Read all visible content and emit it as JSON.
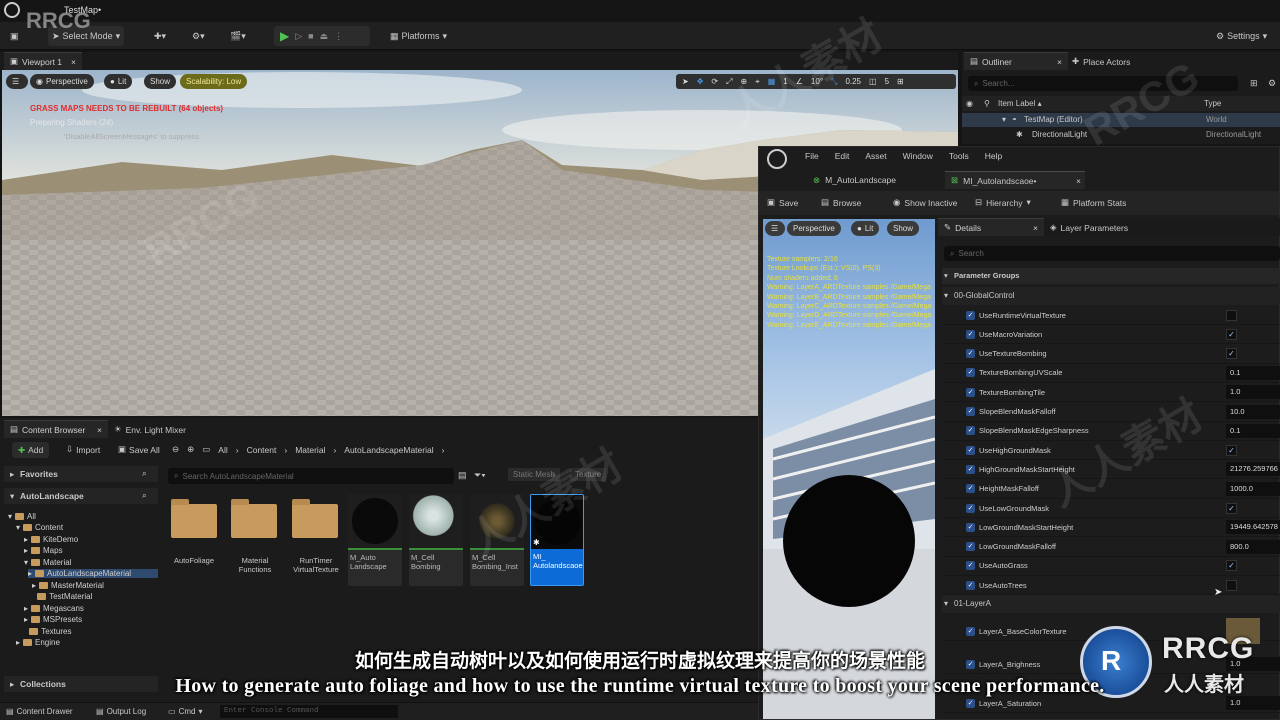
{
  "app": {
    "map_name": "TestMap•",
    "mode": "Select Mode",
    "platforms": "Platforms",
    "settings": "Settings"
  },
  "viewport": {
    "tab": "Viewport 1",
    "perspective": "Perspective",
    "lit": "Lit",
    "show": "Show",
    "scalability": "Scalability: Low",
    "warning": "GRASS MAPS NEEDS TO BE REBUILT (64 objects)",
    "shaders": "Preparing Shaders (24)",
    "suppress": "'DisableAllScreenMessages' to suppress",
    "grid": "1",
    "angle": "10°",
    "scale": "0.25",
    "cam_speed": "5"
  },
  "outliner": {
    "tab": "Outliner",
    "place_actors": "Place Actors",
    "search_placeholder": "Search...",
    "col_label": "Item Label ▴",
    "col_type": "Type",
    "rows": [
      {
        "label": "TestMap (Editor)",
        "type": "World"
      },
      {
        "label": "DirectionalLight",
        "type": "DirectionalLight"
      }
    ]
  },
  "content_browser": {
    "tab": "Content Browser",
    "env_tab": "Env. Light Mixer",
    "add": "Add",
    "import": "Import",
    "save_all": "Save All",
    "crumbs": [
      "All",
      "Content",
      "Material",
      "AutoLandscapeMaterial"
    ],
    "favorites": "Favorites",
    "project": "AutoLandscape",
    "search_placeholder": "Search AutoLandscapeMaterial",
    "filter1": "Static Mesh",
    "filter2": "Texture",
    "collections": "Collections",
    "tree": [
      "All",
      "Content",
      "KiteDemo",
      "Maps",
      "Material",
      "AutoLandscapeMaterial",
      "MasterMaterial",
      "TestMaterial",
      "Megascans",
      "MSPresets",
      "Textures",
      "Engine"
    ],
    "folders": [
      "AutoFoliage",
      "Material Functions",
      "RunTimer VirtualTexture"
    ],
    "assets": [
      "M_Auto Landscape",
      "M_Cell Bombing",
      "M_Cell Bombing_Inst",
      "MI_ Autolandscaoe"
    ]
  },
  "bottom_bar": {
    "drawer": "Content Drawer",
    "output": "Output Log",
    "cmd": "Cmd",
    "console_placeholder": "Enter Console Command"
  },
  "mi_editor": {
    "menus": [
      "File",
      "Edit",
      "Asset",
      "Window",
      "Tools",
      "Help"
    ],
    "tab1": "M_AutoLandscape",
    "tab2": "MI_Autolandscaoe•",
    "save": "Save",
    "browse": "Browse",
    "show_inactive": "Show Inactive",
    "hierarchy": "Hierarchy",
    "platform_stats": "Platform Stats",
    "preview": {
      "perspective": "Perspective",
      "lit": "Lit",
      "show": "Show"
    },
    "stats": [
      "Texture samplers: 2/16",
      "Texture Lookups (Est.): VS(0), PS(3)",
      "Num shaders added: 6",
      "Warning: LayerA_ARDTexture samples /Game/Mega",
      "Warning: LayerB_ARDTexture samples /Game/Mega",
      "Warning: LayerC_ARDTexture samples /Game/Mega",
      "Warning: LayerD_ARDTexture samples /Game/Mega",
      "Warning: LayerE_ARDTexture samples /Game/Mega"
    ],
    "details": "Details",
    "layer_params": "Layer Parameters",
    "search_placeholder": "Search",
    "param_groups": "Parameter Groups",
    "group0": "00-GlobalControl",
    "group1": "01-LayerA",
    "params": [
      {
        "name": "UseRuntimeVirtualTexture",
        "kind": "check",
        "value": ""
      },
      {
        "name": "UseMacroVariation",
        "kind": "check",
        "value": "✓"
      },
      {
        "name": "UseTextureBombing",
        "kind": "check",
        "value": "✓"
      },
      {
        "name": "TextureBombingUVScale",
        "kind": "num",
        "value": "0.1"
      },
      {
        "name": "TextureBombingTile",
        "kind": "num",
        "value": "1.0"
      },
      {
        "name": "SlopeBlendMaskFalloff",
        "kind": "num",
        "value": "10.0"
      },
      {
        "name": "SlopeBlendMaskEdgeSharpness",
        "kind": "num",
        "value": "0.1"
      },
      {
        "name": "UseHighGroundMask",
        "kind": "check",
        "value": "✓"
      },
      {
        "name": "HighGroundMaskStartHeight",
        "kind": "num",
        "value": "21276.259766"
      },
      {
        "name": "HeightMaskFalloff",
        "kind": "num",
        "value": "1000.0"
      },
      {
        "name": "UseLowGroundMask",
        "kind": "check",
        "value": "✓"
      },
      {
        "name": "LowGroundMaskStartHeight",
        "kind": "num",
        "value": "19449.642578"
      },
      {
        "name": "LowGroundMaskFalloff",
        "kind": "num",
        "value": "800.0"
      },
      {
        "name": "UseAutoGrass",
        "kind": "check",
        "value": "✓"
      },
      {
        "name": "UseAutoTrees",
        "kind": "check",
        "value": ""
      }
    ],
    "layer_params_list": [
      {
        "name": "LayerA_BaseColorTexture",
        "kind": "tex",
        "value": ""
      },
      {
        "name": "LayerA_Brighness",
        "kind": "num",
        "value": "1.0"
      },
      {
        "name": "LayerA_Saturation",
        "kind": "num",
        "value": "1.0"
      }
    ]
  },
  "subtitles": {
    "zh": "如何生成自动树叶以及如何使用运行时虚拟纹理来提高你的场景性能",
    "en": "How to generate auto foliage and how to use the runtime virtual texture to boost your scene performance."
  },
  "watermark": {
    "logo": "RRCG",
    "site": "人人素材"
  }
}
